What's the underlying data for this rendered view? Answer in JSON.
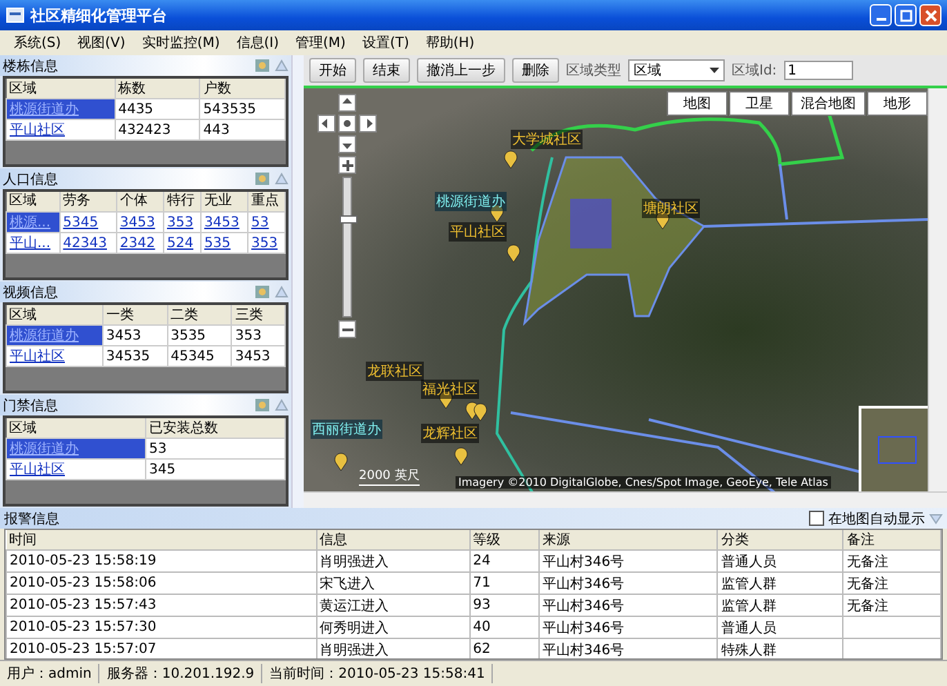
{
  "window": {
    "title": "社区精细化管理平台"
  },
  "menu": [
    "系统(S)",
    "视图(V)",
    "实时监控(M)",
    "信息(I)",
    "管理(M)",
    "设置(T)",
    "帮助(H)"
  ],
  "panels": [
    {
      "title": "楼栋信息",
      "columns": [
        "区域",
        "栋数",
        "户数"
      ],
      "rows": [
        {
          "selected": true,
          "cells": [
            "桃源街道办",
            "4435",
            "543535"
          ]
        },
        {
          "selected": false,
          "cells": [
            "平山社区",
            "432423",
            "443"
          ]
        }
      ]
    },
    {
      "title": "人口信息",
      "columns": [
        "区域",
        "劳务",
        "个体",
        "特行",
        "无业",
        "重点"
      ],
      "rows": [
        {
          "selected": true,
          "cells": [
            "桃源...",
            "5345",
            "3453",
            "353",
            "3453",
            "53"
          ]
        },
        {
          "selected": false,
          "cells": [
            "平山...",
            "42343",
            "2342",
            "524",
            "535",
            "353"
          ]
        }
      ]
    },
    {
      "title": "视频信息",
      "columns": [
        "区域",
        "一类",
        "二类",
        "三类"
      ],
      "rows": [
        {
          "selected": true,
          "cells": [
            "桃源街道办",
            "3453",
            "3535",
            "353"
          ]
        },
        {
          "selected": false,
          "cells": [
            "平山社区",
            "34535",
            "45345",
            "3453"
          ]
        }
      ]
    },
    {
      "title": "门禁信息",
      "columns": [
        "区域",
        "已安装总数"
      ],
      "rows": [
        {
          "selected": true,
          "cells": [
            "桃源街道办",
            "53"
          ]
        },
        {
          "selected": false,
          "cells": [
            "平山社区",
            "345"
          ]
        }
      ]
    }
  ],
  "toolbar": {
    "buttons": [
      "开始",
      "结束",
      "撤消上一步",
      "删除"
    ],
    "type_label": "区域类型",
    "type_value": "区域",
    "id_label": "区域Id:",
    "id_value": "1"
  },
  "map": {
    "types": [
      "地图",
      "卫星",
      "混合地图",
      "地形"
    ],
    "labels": [
      {
        "text": "大学城社区",
        "kind": "community"
      },
      {
        "text": "桃源街道办",
        "kind": "office"
      },
      {
        "text": "平山社区",
        "kind": "community"
      },
      {
        "text": "塘朗社区",
        "kind": "community"
      },
      {
        "text": "龙联社区",
        "kind": "community"
      },
      {
        "text": "福光社区",
        "kind": "community"
      },
      {
        "text": "西丽街道办",
        "kind": "office"
      },
      {
        "text": "龙辉社区",
        "kind": "community"
      }
    ],
    "zoom": {
      "level": 0.72
    },
    "scale": "2000 英尺",
    "copyright": "Imagery ©2010 DigitalGlobe, Cnes/Spot Image, GeoEye, Tele Atlas"
  },
  "alarms": {
    "title": "报警信息",
    "auto_show": {
      "label": "在地图自动显示",
      "checked": false
    },
    "columns": [
      "时间",
      "信息",
      "等级",
      "来源",
      "分类",
      "备注"
    ],
    "rows": [
      [
        "2010-05-23 15:58:19",
        "肖明强进入",
        "24",
        "平山村346号",
        "普通人员",
        "无备注"
      ],
      [
        "2010-05-23 15:58:06",
        "宋飞进入",
        "71",
        "平山村346号",
        "监管人群",
        "无备注"
      ],
      [
        "2010-05-23 15:57:43",
        "黄运江进入",
        "93",
        "平山村346号",
        "监管人群",
        "无备注"
      ],
      [
        "2010-05-23 15:57:30",
        "何秀明进入",
        "40",
        "平山村346号",
        "普通人员"
      ],
      [
        "2010-05-23 15:57:07",
        "肖明强进入",
        "62",
        "平山村346号",
        "特殊人群"
      ]
    ]
  },
  "status": [
    "用户：admin",
    "服务器：10.201.192.9",
    "当前时间：2010-05-23 15:58:41"
  ]
}
